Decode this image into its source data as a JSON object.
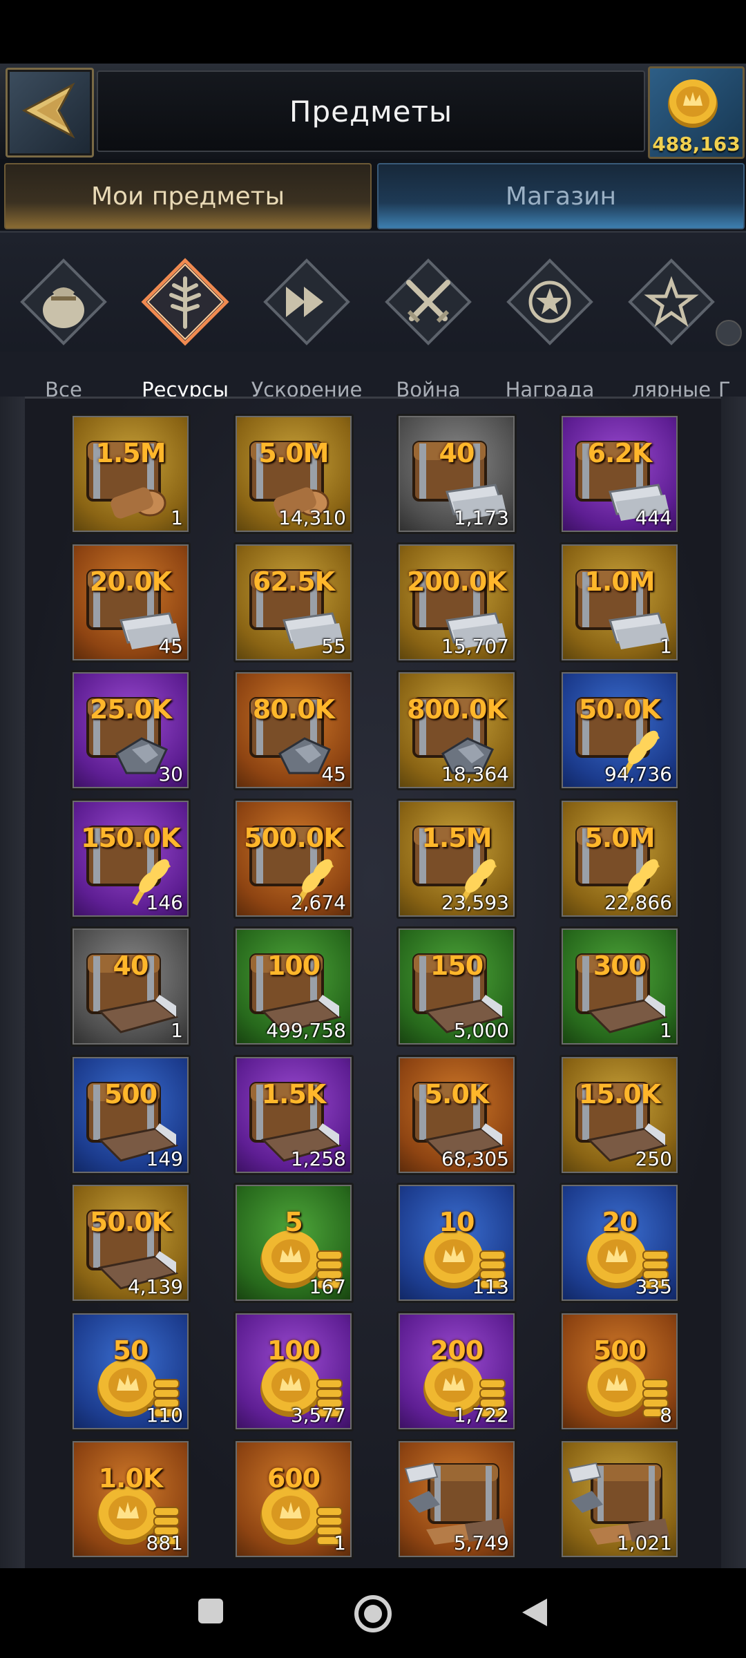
{
  "header": {
    "title": "Предметы",
    "coin_count": "488,163"
  },
  "tabs": [
    {
      "label": "Мои предметы",
      "active": true
    },
    {
      "label": "Магазин",
      "active": false
    }
  ],
  "categories": [
    {
      "label": "Все",
      "icon": "bag-icon"
    },
    {
      "label": "Ресурсы",
      "icon": "tree-icon",
      "active": true
    },
    {
      "label": "Ускорение",
      "icon": "fast-forward-icon"
    },
    {
      "label": "Война",
      "icon": "crossed-swords-icon"
    },
    {
      "label": "Награда",
      "icon": "medal-icon"
    },
    {
      "label": "лярные",
      "icon": "star-icon"
    },
    {
      "label": "Г",
      "icon": ""
    }
  ],
  "items": [
    {
      "amount": "1.5M",
      "count": "1",
      "color": "gold",
      "kind": "wood"
    },
    {
      "amount": "5.0M",
      "count": "14,310",
      "color": "gold",
      "kind": "wood"
    },
    {
      "amount": "40",
      "count": "1,173",
      "color": "gray",
      "kind": "iron"
    },
    {
      "amount": "6.2K",
      "count": "444",
      "color": "purple",
      "kind": "iron"
    },
    {
      "amount": "20.0K",
      "count": "45",
      "color": "orange",
      "kind": "iron"
    },
    {
      "amount": "62.5K",
      "count": "55",
      "color": "gold",
      "kind": "iron"
    },
    {
      "amount": "200.0K",
      "count": "15,707",
      "color": "gold",
      "kind": "iron"
    },
    {
      "amount": "1.0M",
      "count": "1",
      "color": "gold",
      "kind": "iron"
    },
    {
      "amount": "25.0K",
      "count": "30",
      "color": "purple",
      "kind": "ore"
    },
    {
      "amount": "80.0K",
      "count": "45",
      "color": "orange",
      "kind": "ore"
    },
    {
      "amount": "800.0K",
      "count": "18,364",
      "color": "gold",
      "kind": "ore"
    },
    {
      "amount": "50.0K",
      "count": "94,736",
      "color": "blue",
      "kind": "wheat"
    },
    {
      "amount": "150.0K",
      "count": "146",
      "color": "purple",
      "kind": "wheat"
    },
    {
      "amount": "500.0K",
      "count": "2,674",
      "color": "orange",
      "kind": "wheat"
    },
    {
      "amount": "1.5M",
      "count": "23,593",
      "color": "gold",
      "kind": "wheat"
    },
    {
      "amount": "5.0M",
      "count": "22,866",
      "color": "gold",
      "kind": "wheat"
    },
    {
      "amount": "40",
      "count": "1",
      "color": "gray",
      "kind": "stone"
    },
    {
      "amount": "100",
      "count": "499,758",
      "color": "green",
      "kind": "stone"
    },
    {
      "amount": "150",
      "count": "5,000",
      "color": "green",
      "kind": "stone"
    },
    {
      "amount": "300",
      "count": "1",
      "color": "green",
      "kind": "stone"
    },
    {
      "amount": "500",
      "count": "149",
      "color": "blue",
      "kind": "stone"
    },
    {
      "amount": "1.5K",
      "count": "1,258",
      "color": "purple",
      "kind": "stone"
    },
    {
      "amount": "5.0K",
      "count": "68,305",
      "color": "orange",
      "kind": "stone"
    },
    {
      "amount": "15.0K",
      "count": "250",
      "color": "gold",
      "kind": "stone"
    },
    {
      "amount": "50.0K",
      "count": "4,139",
      "color": "gold",
      "kind": "stone"
    },
    {
      "amount": "5",
      "count": "167",
      "color": "green",
      "kind": "coins"
    },
    {
      "amount": "10",
      "count": "113",
      "color": "blue",
      "kind": "coins"
    },
    {
      "amount": "20",
      "count": "335",
      "color": "blue",
      "kind": "coins"
    },
    {
      "amount": "50",
      "count": "110",
      "color": "blue",
      "kind": "coins"
    },
    {
      "amount": "100",
      "count": "3,577",
      "color": "purple",
      "kind": "coins"
    },
    {
      "amount": "200",
      "count": "1,722",
      "color": "purple",
      "kind": "coins"
    },
    {
      "amount": "500",
      "count": "8",
      "color": "orange",
      "kind": "coins"
    },
    {
      "amount": "1.0K",
      "count": "881",
      "color": "orange",
      "kind": "coins"
    },
    {
      "amount": "600",
      "count": "1",
      "color": "orange",
      "kind": "coins"
    },
    {
      "amount": "",
      "count": "5,749",
      "color": "orange",
      "kind": "multi"
    },
    {
      "amount": "",
      "count": "1,021",
      "color": "gold",
      "kind": "multi"
    }
  ],
  "colors": {
    "amount_text": "#ffb72b",
    "coin_count_text": "#f0d050"
  }
}
